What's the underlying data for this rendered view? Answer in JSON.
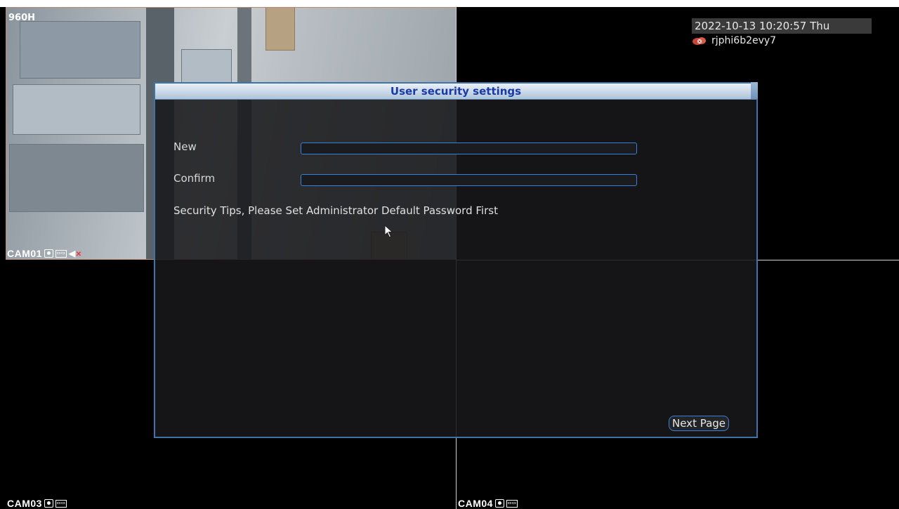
{
  "camera_view": {
    "resolution_label": "960H",
    "datetime": "2022-10-13 10:20:57 Thu",
    "cloud_id": "rjphi6b2evy7",
    "cameras": [
      {
        "label": "CAM01"
      },
      {
        "label": "CAM03"
      },
      {
        "label": "CAM04"
      }
    ]
  },
  "dialog": {
    "title": "User security settings",
    "new_label": "New",
    "confirm_label": "Confirm",
    "new_value": "",
    "confirm_value": "",
    "tips": "Security Tips, Please Set Administrator Default Password First",
    "next_button": "Next Page"
  },
  "colors": {
    "title_text": "#1a3aa8",
    "input_border": "#3a7fd8",
    "dialog_border": "#3f74a8"
  },
  "icons": [
    "record-icon",
    "stream-icon",
    "audio-muted-icon",
    "cloud-icon",
    "mouse-cursor-icon"
  ]
}
